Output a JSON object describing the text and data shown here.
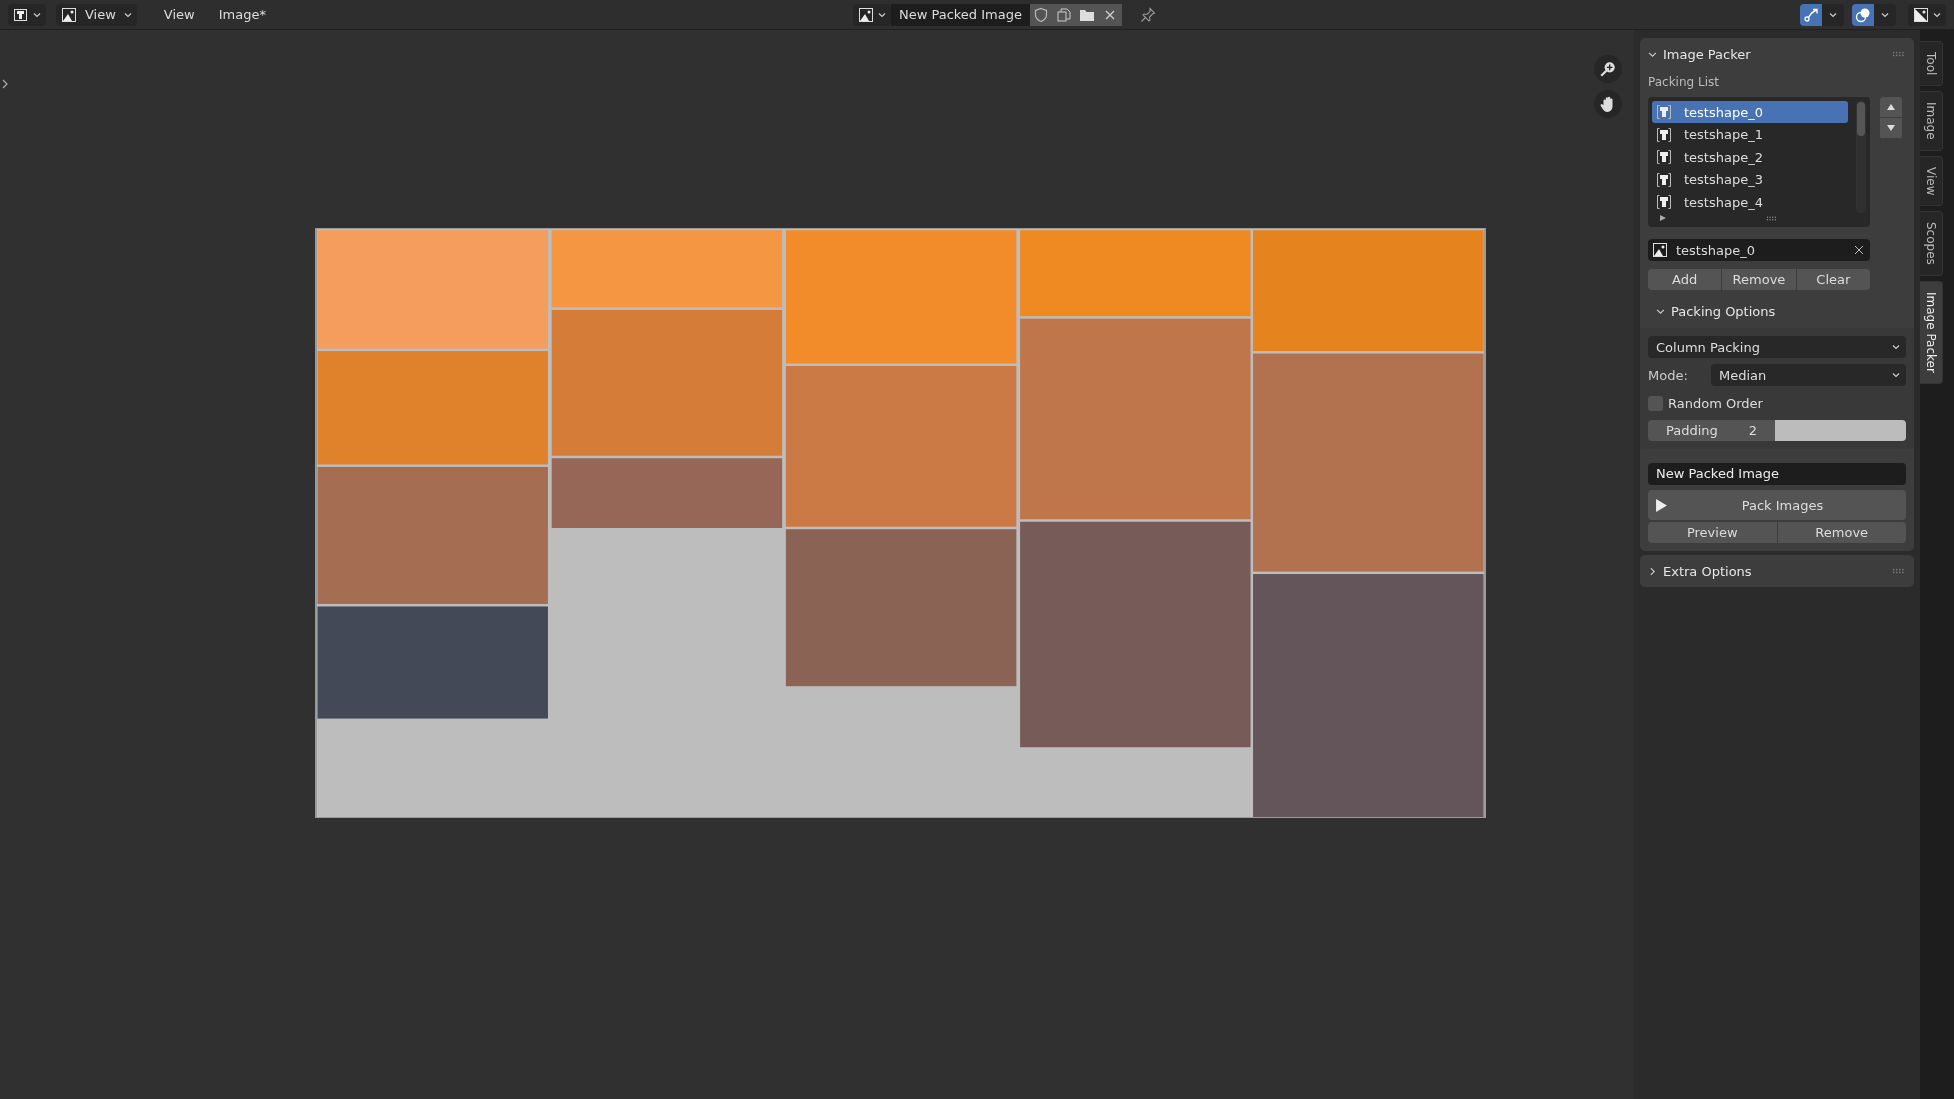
{
  "header": {
    "view_dropdown": "View",
    "menus": [
      "View",
      "Image*"
    ],
    "image_name": "New Packed Image",
    "toggles": [
      {
        "kind": "gizmo",
        "on": true
      },
      {
        "kind": "overlay",
        "on": true
      }
    ]
  },
  "panel": {
    "title": "Image Packer",
    "expanded": true,
    "packing_list": {
      "label": "Packing List",
      "items": [
        {
          "name": "testshape_0",
          "selected": true
        },
        {
          "name": "testshape_1",
          "selected": false
        },
        {
          "name": "testshape_2",
          "selected": false
        },
        {
          "name": "testshape_3",
          "selected": false
        },
        {
          "name": "testshape_4",
          "selected": false
        }
      ]
    },
    "active_image": "testshape_0",
    "list_buttons": [
      "Add",
      "Remove",
      "Clear"
    ],
    "packing_options": {
      "title": "Packing Options",
      "expanded": true,
      "method": "Column Packing",
      "mode_label": "Mode:",
      "mode": "Median",
      "random_order": {
        "label": "Random Order",
        "checked": false
      },
      "padding": {
        "label": "Padding",
        "value": "2"
      }
    },
    "output_name": "New Packed Image",
    "pack_button": "Pack Images",
    "action_buttons": [
      "Preview",
      "Remove"
    ],
    "extra_options": {
      "title": "Extra Options",
      "expanded": false
    }
  },
  "tabs": [
    {
      "label": "Tool",
      "selected": false
    },
    {
      "label": "Image",
      "selected": false
    },
    {
      "label": "View",
      "selected": false
    },
    {
      "label": "Scopes",
      "selected": false
    },
    {
      "label": "Image Packer",
      "selected": true
    }
  ]
}
